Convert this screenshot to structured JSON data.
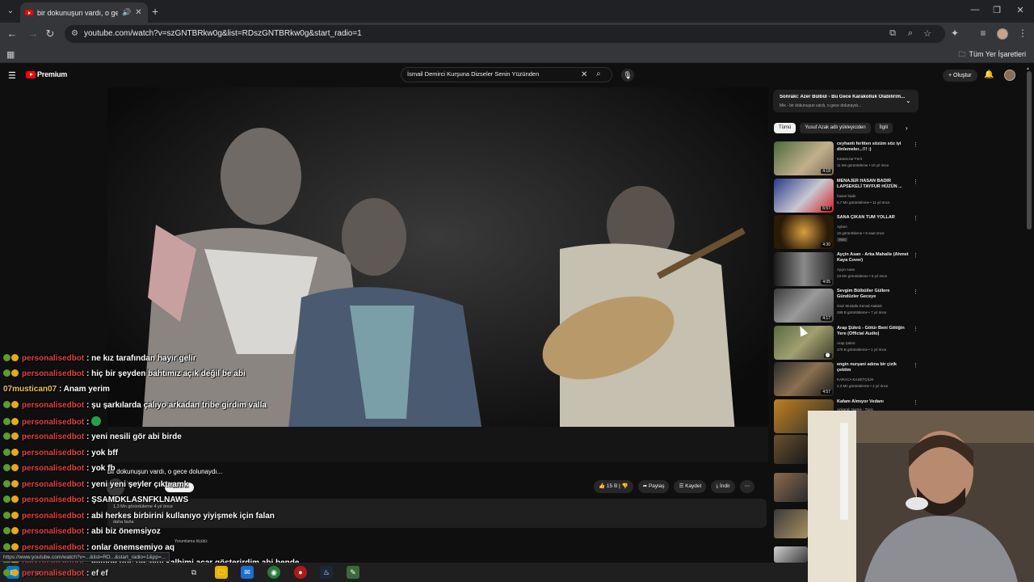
{
  "browser": {
    "tab_title": "bir dokunuşun vardı, o gece",
    "url": "youtube.com/watch?v=szGNTBRkw0g&list=RDszGNTBRkw0g&start_radio=1",
    "bookmarks_folder": "Tüm Yer İşaretleri",
    "status_url": "https://www.youtube.com/watch?v=...&list=RD...&start_radio=1&pp=..."
  },
  "youtube": {
    "logo": "Premium",
    "search_query": "İsmail Demirci Kurşuna Dizseler Senin Yüzünden",
    "create_label": "Oluştur"
  },
  "video": {
    "title": "bir dokunuşun vardı, o gece dolunaydı...",
    "channel": "Yusuf Azak",
    "subscribe_label": "Abone ol",
    "likes": "15 B",
    "share_label": "Paylaş",
    "save_label": "Kaydet",
    "download_label": "İndir",
    "desc_line": "1,3 Mn görüntüleme  4 yıl önce",
    "desc_more": "daha fazla",
    "comment_hint": "Yorumlama ölçütü:"
  },
  "upnext": {
    "title": "Sonraki: Azer Bülbül - Bu Gece Karakolluk Olabilirim...",
    "subtitle": "Mix - bir dokunuşun vardı, o gece dolunaydı..."
  },
  "chips": [
    {
      "label": "Tümü",
      "active": true
    },
    {
      "label": "Yusuf Azak adlı yükleyiciden",
      "active": false
    },
    {
      "label": "İlgili",
      "active": false
    }
  ],
  "recommendations": [
    {
      "title": "ceyhanlı feritten sözüm söz iyi dinlemeler...!!! :)",
      "channel": "Karamızar Ferit",
      "meta": "11 Mn görüntüleme • 10 yıl önce",
      "duration": "4:18"
    },
    {
      "title": "MENAJER HASAN BADIR LAPSEKELİ TAYFUR HÜZÜN ...",
      "channel": "hasan badır",
      "meta": "5,7 Mn görüntüleme • 11 yıl önce",
      "duration": "6:57"
    },
    {
      "title": "SANA ÇIKAN TÜM YOLLAR",
      "channel": "Ayben",
      "meta": "16 görüntüleme • 5 saat önce",
      "duration": "4:30",
      "badge": "Yeni"
    },
    {
      "title": "Ayçin Asan - Arka Mahalle (Ahmet Kaya Cover)",
      "channel": "Ayçin Asan",
      "meta": "23 Mn görüntüleme • 6 yıl önce",
      "duration": "4:05"
    },
    {
      "title": "Sevgim Bülbüller Güllere Gündüzler Geceye",
      "channel": "Gazi Mustafa Kemal Atatürk",
      "meta": "289 B görüntüleme • 7 yıl önce",
      "duration": "4:17"
    },
    {
      "title": "Arap Şükrü - Götür Beni Gittiğin Yere (Official Audio)",
      "channel": "Arap Şükrü",
      "meta": "275 B görüntüleme • 1 yıl önce",
      "duration": ""
    },
    {
      "title": "engin nurşani adına bir çizik çektim",
      "channel": "KARACA KASETÇİLİK",
      "meta": "2,3 Mn görüntüleme • 4 yıl önce",
      "duration": "4:57"
    },
    {
      "title": "Kafam Almıyor Vedanı",
      "channel": "Ankaralı Namık - Topic",
      "meta": "",
      "duration": ""
    }
  ],
  "chat": [
    {
      "nick": "personalisedbot",
      "msg": ": ne kız tarafından hayır gelir",
      "badges": true
    },
    {
      "nick": "personalisedbot",
      "msg": ": hiç bir şeyden bahtımız açık değil be abi",
      "badges": true
    },
    {
      "nick": "07mustican07",
      "msg": ": Anam yerim",
      "badges": false
    },
    {
      "nick": "personalisedbot",
      "msg": ": şu şarkılarda çalıyo arkadan tribe girdim valla",
      "badges": true
    },
    {
      "nick": "personalisedbot",
      "msg": ":",
      "badges": true,
      "emote": true
    },
    {
      "nick": "personalisedbot",
      "msg": ": yeni nesili gör abi birde",
      "badges": true
    },
    {
      "nick": "personalisedbot",
      "msg": ": yok bff",
      "badges": true
    },
    {
      "nick": "personalisedbot",
      "msg": ": yok fb",
      "badges": true
    },
    {
      "nick": "personalisedbot",
      "msg": ": yeni yeni şeyler çıktı amk",
      "badges": true
    },
    {
      "nick": "personalisedbot",
      "msg": ": ŞSAMDKLASNFKLNAWS",
      "badges": true
    },
    {
      "nick": "personalisedbot",
      "msg": ": abi herkes birbirini kullanıyo yiyişmek için falan",
      "badges": true
    },
    {
      "nick": "personalisedbot",
      "msg": ": abi biz önemsiyoz",
      "badges": true
    },
    {
      "nick": "personalisedbot",
      "msg": ": onlar önemsemiyo aq",
      "badges": true
    },
    {
      "nick": "personalisedbot",
      "msg": ": elimde güç olsaydı kalbimi açar gösterirdim abi bende",
      "badges": true
    }
  ],
  "chat_last": {
    "nick": "personalisedbot",
    "msg": ": ef ef"
  },
  "colors": {
    "nick_bot": "#e43f3f",
    "nick_user": "#f0c23b",
    "yt_red": "#ff0000",
    "bg": "#0f0f0f"
  },
  "icons": [
    "youtube-icon",
    "search-icon",
    "mic-icon",
    "bell-icon",
    "like-icon",
    "dislike-icon",
    "share-icon",
    "save-icon",
    "download-icon"
  ]
}
